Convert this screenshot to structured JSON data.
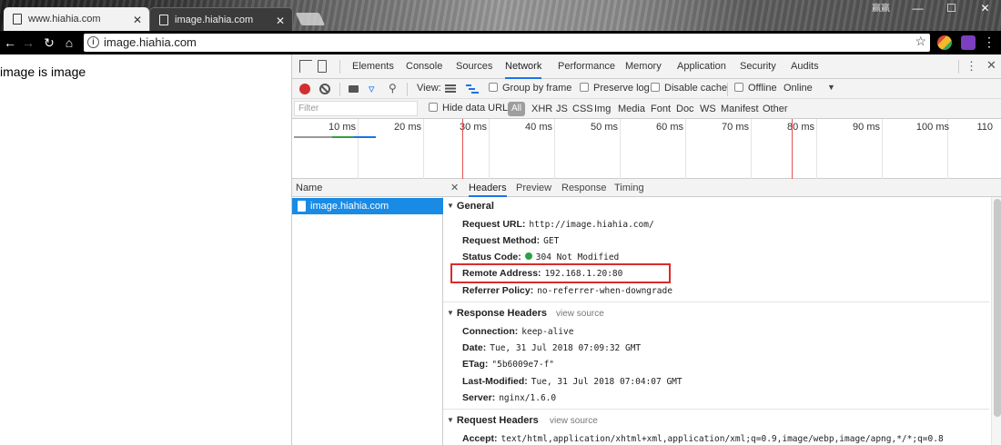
{
  "browser": {
    "tabs": [
      {
        "title": "www.hiahia.com",
        "close": "✕"
      },
      {
        "title": "image.hiahia.com",
        "close": "✕"
      }
    ],
    "address": "image.hiahia.com",
    "window_controls": {
      "minimize": "—",
      "maximize": "☐",
      "close": "✕"
    },
    "corner_mark": "赢赢"
  },
  "page": {
    "text": "image is image"
  },
  "devtools": {
    "tabs": [
      "Elements",
      "Console",
      "Sources",
      "Network",
      "Performance",
      "Memory",
      "Application",
      "Security",
      "Audits"
    ],
    "active_tab": "Network",
    "toolbar": {
      "view_label": "View:",
      "group_by_frame": "Group by frame",
      "preserve_log": "Preserve log",
      "disable_cache": "Disable cache",
      "offline": "Offline",
      "throttling": "Online"
    },
    "filter": {
      "placeholder": "Filter",
      "hide_data_urls": "Hide data URLs",
      "types": [
        "All",
        "XHR",
        "JS",
        "CSS",
        "Img",
        "Media",
        "Font",
        "Doc",
        "WS",
        "Manifest",
        "Other"
      ]
    },
    "overview": {
      "ticks": [
        "10 ms",
        "20 ms",
        "30 ms",
        "40 ms",
        "50 ms",
        "60 ms",
        "70 ms",
        "80 ms",
        "90 ms",
        "100 ms",
        "110"
      ]
    },
    "requests": {
      "column": "Name",
      "rows": [
        "image.hiahia.com"
      ]
    },
    "detail_tabs": [
      "Headers",
      "Preview",
      "Response",
      "Timing"
    ],
    "active_detail_tab": "Headers",
    "general": {
      "title": "General",
      "rows": [
        {
          "key": "Request URL:",
          "value": "http://image.hiahia.com/"
        },
        {
          "key": "Request Method:",
          "value": "GET"
        },
        {
          "key": "Status Code:",
          "value": "304 Not Modified"
        },
        {
          "key": "Remote Address:",
          "value": "192.168.1.20:80"
        },
        {
          "key": "Referrer Policy:",
          "value": "no-referrer-when-downgrade"
        }
      ]
    },
    "response_headers": {
      "title": "Response Headers",
      "view_source": "view source",
      "rows": [
        {
          "key": "Connection:",
          "value": "keep-alive"
        },
        {
          "key": "Date:",
          "value": "Tue, 31 Jul 2018 07:09:32 GMT"
        },
        {
          "key": "ETag:",
          "value": "\"5b6009e7-f\""
        },
        {
          "key": "Last-Modified:",
          "value": "Tue, 31 Jul 2018 07:04:07 GMT"
        },
        {
          "key": "Server:",
          "value": "nginx/1.6.0"
        }
      ]
    },
    "request_headers": {
      "title": "Request Headers",
      "view_source": "view source",
      "rows": [
        {
          "key": "Accept:",
          "value": "text/html,application/xhtml+xml,application/xml;q=0.9,image/webp,image/apng,*/*;q=0.8"
        }
      ]
    },
    "colors": {
      "accent": "#1a73e8",
      "selection": "#1a8be5",
      "record": "#d32f2f",
      "highlight": "#d92b2b",
      "status_ok": "#2ea043"
    }
  }
}
